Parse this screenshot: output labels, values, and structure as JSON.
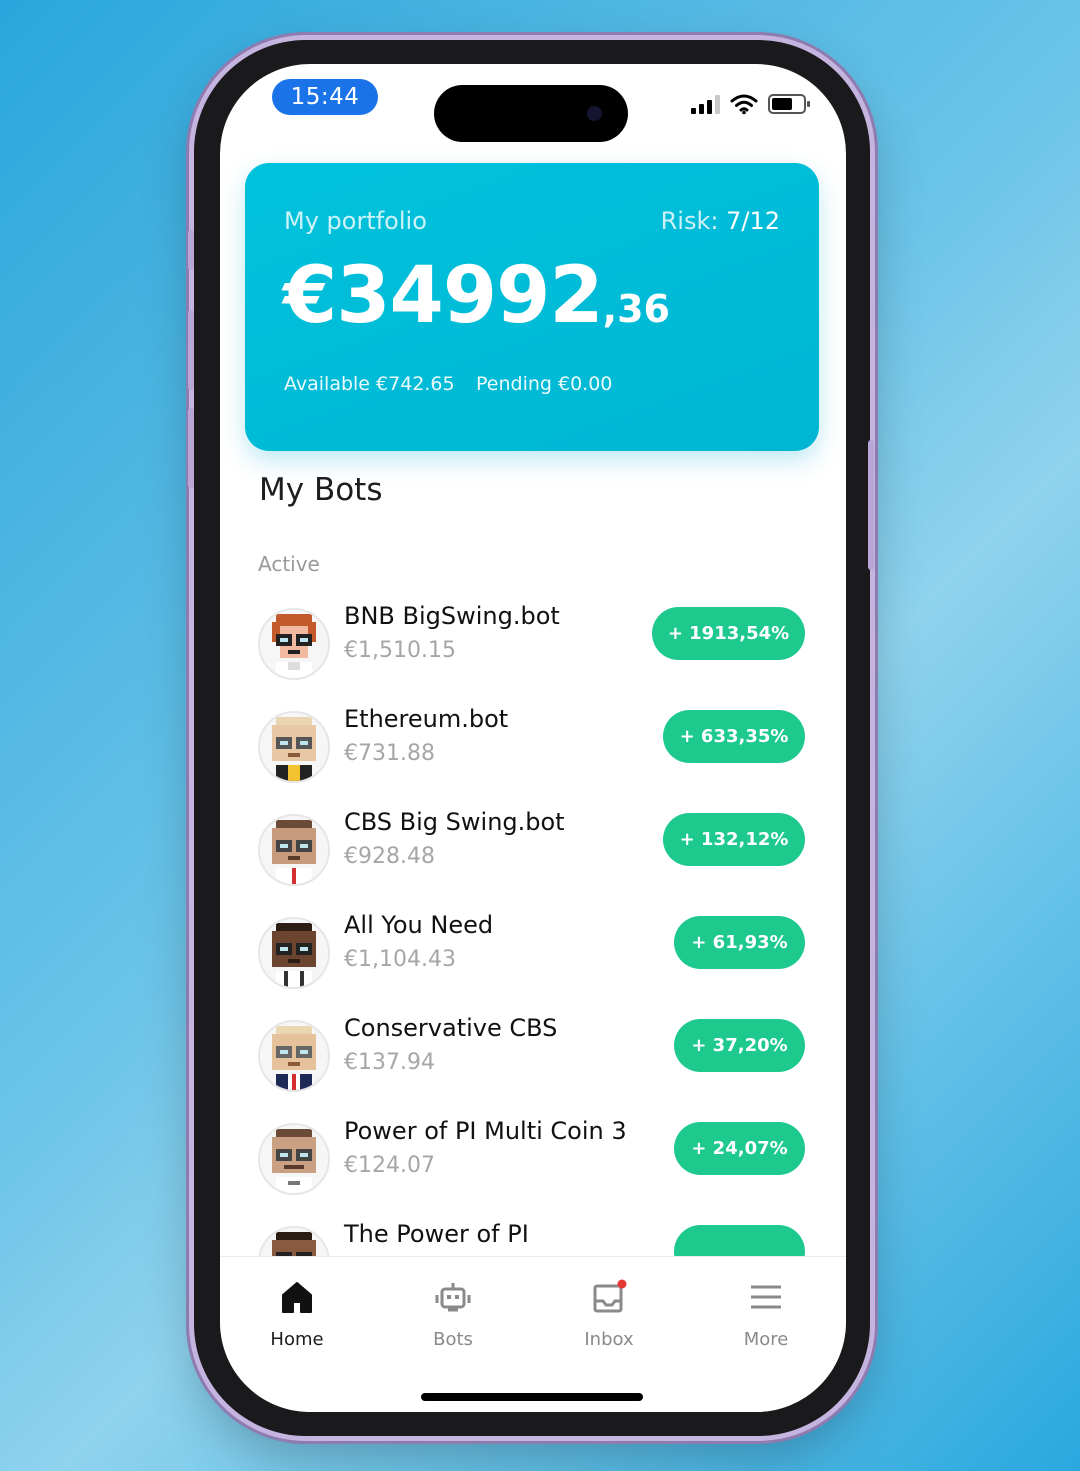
{
  "status_bar": {
    "time": "15:44"
  },
  "portfolio": {
    "label": "My portfolio",
    "risk_label": "Risk:",
    "risk_value": "7/12",
    "balance_main": "€34992",
    "balance_cents": ",36",
    "available": "Available €742.65",
    "pending": "Pending €0.00"
  },
  "bots_section": {
    "title": "My Bots",
    "subtitle": "Active",
    "items": [
      {
        "name": "BNB BigSwing.bot",
        "value": "€1,510.15",
        "change": "+ 1913,54%"
      },
      {
        "name": "Ethereum.bot",
        "value": "€731.88",
        "change": "+ 633,35%"
      },
      {
        "name": "CBS Big Swing.bot",
        "value": "€928.48",
        "change": "+ 132,12%"
      },
      {
        "name": "All You Need",
        "value": "€1,104.43",
        "change": "+ 61,93%"
      },
      {
        "name": "Conservative CBS",
        "value": "€137.94",
        "change": "+ 37,20%"
      },
      {
        "name": "Power of PI Multi Coin 3",
        "value": "€124.07",
        "change": "+ 24,07%"
      },
      {
        "name": "The Power of PI",
        "value": "",
        "change": ""
      }
    ]
  },
  "tabbar": {
    "tabs": [
      {
        "label": "Home",
        "icon": "home-icon",
        "active": true
      },
      {
        "label": "Bots",
        "icon": "robot-icon",
        "active": false
      },
      {
        "label": "Inbox",
        "icon": "inbox-icon",
        "active": false,
        "badge": true
      },
      {
        "label": "More",
        "icon": "menu-icon",
        "active": false
      }
    ]
  },
  "colors": {
    "card": "#00bcd8",
    "positive_pill": "#1ec98e",
    "status_time_pill": "#1a73e8",
    "notification_dot": "#e53935"
  }
}
